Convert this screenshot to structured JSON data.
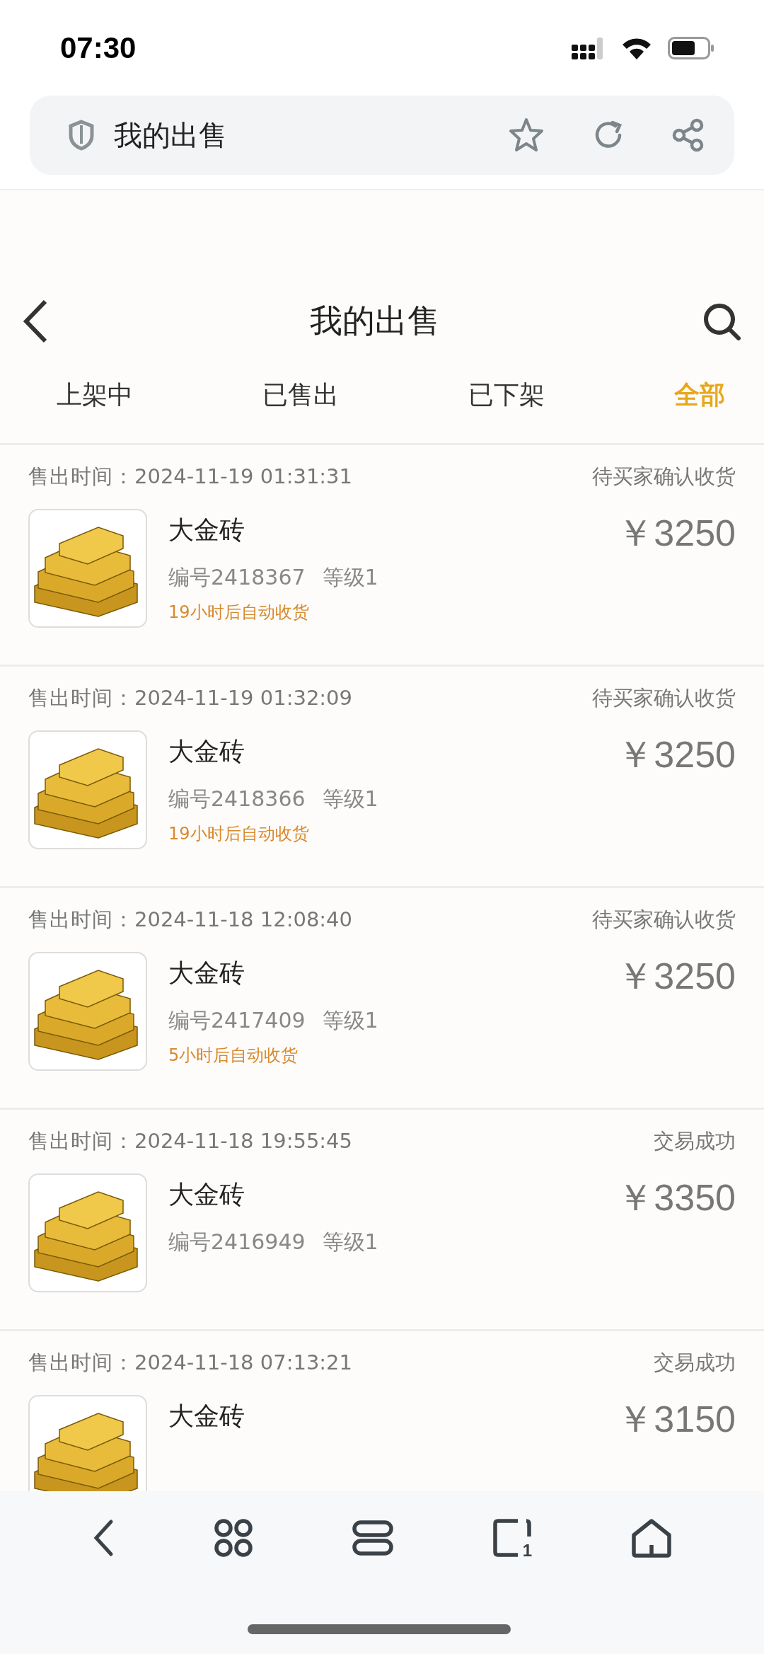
{
  "status_bar": {
    "time": "07:30"
  },
  "browser_bar": {
    "title": "我的出售",
    "tab_count": "1"
  },
  "header": {
    "title": "我的出售"
  },
  "tabs": [
    {
      "label": "上架中",
      "selected": false
    },
    {
      "label": "已售出",
      "selected": false
    },
    {
      "label": "已下架",
      "selected": false
    },
    {
      "label": "全部",
      "selected": true
    }
  ],
  "orders": [
    {
      "time_label": "售出时间：",
      "time": "2024-11-19 01:31:31",
      "status": "待买家确认收货",
      "name": "大金砖",
      "code": "编号2418367",
      "level": "等级1",
      "price": "￥3250",
      "hint": "19小时后自动收货"
    },
    {
      "time_label": "售出时间：",
      "time": "2024-11-19 01:32:09",
      "status": "待买家确认收货",
      "name": "大金砖",
      "code": "编号2418366",
      "level": "等级1",
      "price": "￥3250",
      "hint": "19小时后自动收货"
    },
    {
      "time_label": "售出时间：",
      "time": "2024-11-18 12:08:40",
      "status": "待买家确认收货",
      "name": "大金砖",
      "code": "编号2417409",
      "level": "等级1",
      "price": "￥3250",
      "hint": "5小时后自动收货"
    },
    {
      "time_label": "售出时间：",
      "time": "2024-11-18 19:55:45",
      "status": "交易成功",
      "name": "大金砖",
      "code": "编号2416949",
      "level": "等级1",
      "price": "￥3350"
    },
    {
      "time_label": "售出时间：",
      "time": "2024-11-18 07:13:21",
      "status": "交易成功",
      "name": "大金砖",
      "price": "￥3150"
    }
  ]
}
